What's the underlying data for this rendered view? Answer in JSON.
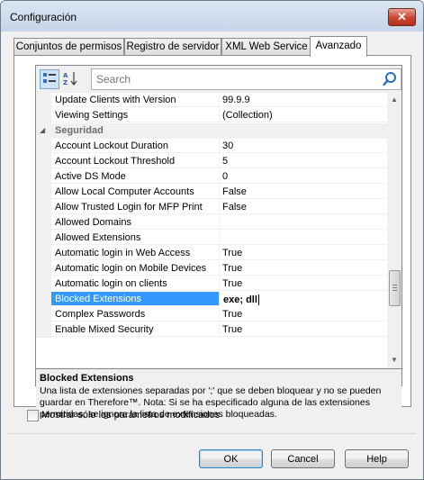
{
  "window": {
    "title": "Configuración",
    "close_glyph": "✕"
  },
  "tabs": [
    {
      "label": "Conjuntos de permisos",
      "active": false
    },
    {
      "label": "Registro de servidor",
      "active": false
    },
    {
      "label": "XML Web Service",
      "active": false
    },
    {
      "label": "Avanzado",
      "active": true
    }
  ],
  "toolbar": {
    "categorized_icon": "categorized-view-icon",
    "alphabetical_icon": "alphabetical-sort-icon",
    "search_placeholder": "Search",
    "search_icon": "search-icon"
  },
  "property_grid": {
    "rows": [
      {
        "type": "prop",
        "name": "Update Clients with Version",
        "value": "99.9.9"
      },
      {
        "type": "prop",
        "name": "Viewing Settings",
        "value": "(Collection)"
      },
      {
        "type": "category",
        "name": "Seguridad",
        "expanded": true
      },
      {
        "type": "prop",
        "name": "Account Lockout Duration",
        "value": "30"
      },
      {
        "type": "prop",
        "name": "Account Lockout Threshold",
        "value": "5"
      },
      {
        "type": "prop",
        "name": "Active DS Mode",
        "value": "0"
      },
      {
        "type": "prop",
        "name": "Allow Local Computer Accounts",
        "value": "False"
      },
      {
        "type": "prop",
        "name": "Allow Trusted Login for MFP Print",
        "value": "False"
      },
      {
        "type": "prop",
        "name": "Allowed Domains",
        "value": ""
      },
      {
        "type": "prop",
        "name": "Allowed Extensions",
        "value": ""
      },
      {
        "type": "prop",
        "name": "Automatic login in Web Access",
        "value": "True"
      },
      {
        "type": "prop",
        "name": "Automatic login on Mobile Devices",
        "value": "True"
      },
      {
        "type": "prop",
        "name": "Automatic login on clients",
        "value": "True"
      },
      {
        "type": "prop",
        "name": "Blocked Extensions",
        "value": "exe; dll",
        "selected": true
      },
      {
        "type": "prop",
        "name": "Complex Passwords",
        "value": "True"
      },
      {
        "type": "prop",
        "name": "Enable Mixed Security",
        "value": "True"
      }
    ],
    "scroll_position": 0.62
  },
  "description": {
    "title": "Blocked Extensions",
    "text": "Una lista de extensiones separadas por ';' que se deben bloquear y no se pueden guardar en Therefore™. Nota: Si se ha especificado alguna de las extensiones permitidas, se ignora la lista de extensiones bloqueadas."
  },
  "show_modified_only": {
    "label": "Mostrar sólo los parámetros modificados",
    "checked": false
  },
  "buttons": {
    "ok": "OK",
    "cancel": "Cancel",
    "help": "Help"
  }
}
